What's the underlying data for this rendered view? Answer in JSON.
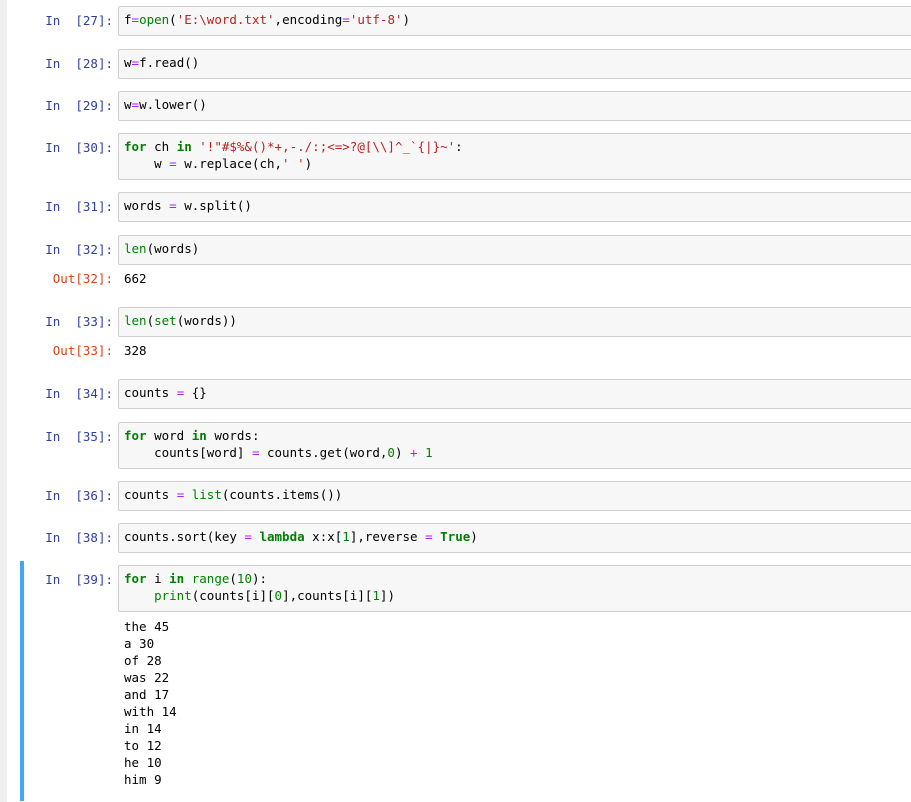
{
  "cells": [
    {
      "id": "c27",
      "prompt": "In  [27]:",
      "lines": [
        [
          [
            "f",
            "pl"
          ],
          [
            "=",
            "op"
          ],
          [
            "open",
            "bi"
          ],
          [
            "(",
            "pl"
          ],
          [
            "'E:\\word.txt'",
            "str"
          ],
          [
            ",encoding",
            "pl"
          ],
          [
            "=",
            "op"
          ],
          [
            "'utf-8'",
            "str"
          ],
          [
            ")",
            "pl"
          ]
        ]
      ]
    },
    {
      "id": "c28",
      "prompt": "In  [28]:",
      "lines": [
        [
          [
            "w",
            "pl"
          ],
          [
            "=",
            "op"
          ],
          [
            "f.read()",
            "pl"
          ]
        ]
      ]
    },
    {
      "id": "c29",
      "prompt": "In  [29]:",
      "lines": [
        [
          [
            "w",
            "pl"
          ],
          [
            "=",
            "op"
          ],
          [
            "w.lower()",
            "pl"
          ]
        ]
      ]
    },
    {
      "id": "c30",
      "prompt": "In  [30]:",
      "lines": [
        [
          [
            "for",
            "kw"
          ],
          [
            " ch ",
            "pl"
          ],
          [
            "in",
            "kw"
          ],
          [
            " ",
            "pl"
          ],
          [
            "'!\"#$%&()*+,-./:;<=>?@[\\\\]^_`{|}~'",
            "str"
          ],
          [
            ":",
            "pl"
          ]
        ],
        [
          [
            "    w ",
            "pl"
          ],
          [
            "=",
            "op"
          ],
          [
            " w.replace(ch,",
            "pl"
          ],
          [
            "' '",
            "str"
          ],
          [
            ")",
            "pl"
          ]
        ]
      ]
    },
    {
      "id": "c31",
      "prompt": "In  [31]:",
      "lines": [
        [
          [
            "words ",
            "pl"
          ],
          [
            "=",
            "op"
          ],
          [
            " w.split()",
            "pl"
          ]
        ]
      ]
    },
    {
      "id": "c32",
      "prompt": "In  [32]:",
      "lines": [
        [
          [
            "len",
            "bi"
          ],
          [
            "(words)",
            "pl"
          ]
        ]
      ],
      "out_prompt": "Out[32]:",
      "output": "662"
    },
    {
      "id": "c33",
      "prompt": "In  [33]:",
      "lines": [
        [
          [
            "len",
            "bi"
          ],
          [
            "(",
            "pl"
          ],
          [
            "set",
            "bi"
          ],
          [
            "(words))",
            "pl"
          ]
        ]
      ],
      "out_prompt": "Out[33]:",
      "output": "328"
    },
    {
      "id": "c34",
      "prompt": "In  [34]:",
      "lines": [
        [
          [
            "counts ",
            "pl"
          ],
          [
            "=",
            "op"
          ],
          [
            " {}",
            "pl"
          ]
        ]
      ]
    },
    {
      "id": "c35",
      "prompt": "In  [35]:",
      "lines": [
        [
          [
            "for",
            "kw"
          ],
          [
            " word ",
            "pl"
          ],
          [
            "in",
            "kw"
          ],
          [
            " words:",
            "pl"
          ]
        ],
        [
          [
            "    counts[word] ",
            "pl"
          ],
          [
            "=",
            "op"
          ],
          [
            " counts.get(word,",
            "pl"
          ],
          [
            "0",
            "num"
          ],
          [
            ") ",
            "pl"
          ],
          [
            "+",
            "op"
          ],
          [
            " ",
            "pl"
          ],
          [
            "1",
            "num"
          ]
        ]
      ]
    },
    {
      "id": "c36",
      "prompt": "In  [36]:",
      "lines": [
        [
          [
            "counts ",
            "pl"
          ],
          [
            "=",
            "op"
          ],
          [
            " ",
            "pl"
          ],
          [
            "list",
            "bi"
          ],
          [
            "(counts.items())",
            "pl"
          ]
        ]
      ]
    },
    {
      "id": "c38",
      "prompt": "In  [38]:",
      "lines": [
        [
          [
            "counts.sort(key ",
            "pl"
          ],
          [
            "=",
            "op"
          ],
          [
            " ",
            "pl"
          ],
          [
            "lambda",
            "kw"
          ],
          [
            " x:x[",
            "pl"
          ],
          [
            "1",
            "num"
          ],
          [
            "],reverse ",
            "pl"
          ],
          [
            "=",
            "op"
          ],
          [
            " ",
            "pl"
          ],
          [
            "True",
            "kw"
          ],
          [
            ")",
            "pl"
          ]
        ]
      ]
    },
    {
      "id": "c39",
      "prompt": "In  [39]:",
      "lines": [
        [
          [
            "for",
            "kw"
          ],
          [
            " i ",
            "pl"
          ],
          [
            "in",
            "kw"
          ],
          [
            " ",
            "pl"
          ],
          [
            "range",
            "bi"
          ],
          [
            "(",
            "pl"
          ],
          [
            "10",
            "num"
          ],
          [
            "):",
            "pl"
          ]
        ],
        [
          [
            "    ",
            "pl"
          ],
          [
            "print",
            "bi"
          ],
          [
            "(counts[i][",
            "pl"
          ],
          [
            "0",
            "num"
          ],
          [
            "],counts[i][",
            "pl"
          ],
          [
            "1",
            "num"
          ],
          [
            "])",
            "pl"
          ]
        ]
      ],
      "stream": [
        "the 45",
        "a 30",
        "of 28",
        "was 22",
        "and 17",
        "with 14",
        "in 14",
        "to 12",
        "he 10",
        "him 9"
      ]
    }
  ],
  "colors": {
    "in_prompt": "#303f9f",
    "out_prompt": "#d84315",
    "selected_border": "#42a5f5",
    "code_bg": "#f7f7f7"
  }
}
